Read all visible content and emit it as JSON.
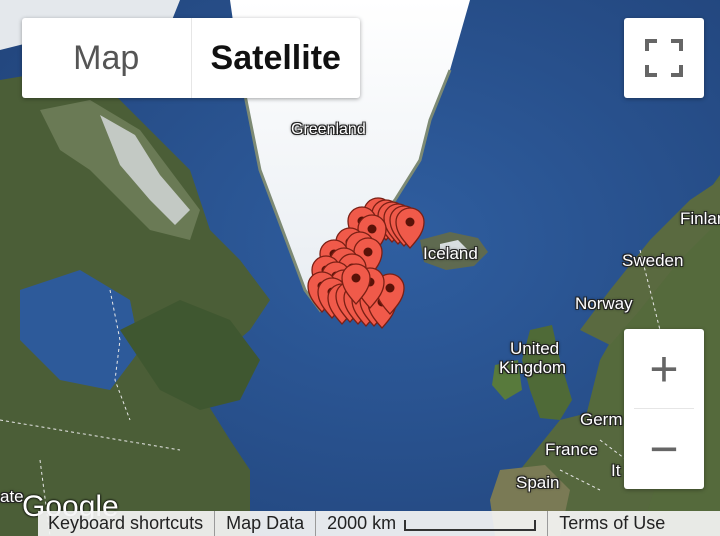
{
  "map": {
    "labels": {
      "greenland": "Greenland",
      "iceland": "Iceland",
      "sweden": "Sweden",
      "finland": "Finlan",
      "norway": "Norway",
      "uk_line1": "United",
      "uk_line2": "Kingdom",
      "germany": "Germ",
      "france": "France",
      "spain": "Spain",
      "italy": "It",
      "states": "ate"
    },
    "marker_count": 28,
    "marker_color": "#f05a4a",
    "ocean_color": "#2a4f87"
  },
  "controls": {
    "map_type": {
      "map_label": "Map",
      "satellite_label": "Satellite",
      "selected": "Satellite"
    },
    "fullscreen_icon": "fullscreen-icon",
    "zoom_in_label": "+",
    "zoom_out_label": "−"
  },
  "footer": {
    "logo": "Google",
    "keyboard_shortcuts": "Keyboard shortcuts",
    "map_data": "Map Data",
    "scale_label": "2000 km",
    "terms": "Terms of Use"
  }
}
